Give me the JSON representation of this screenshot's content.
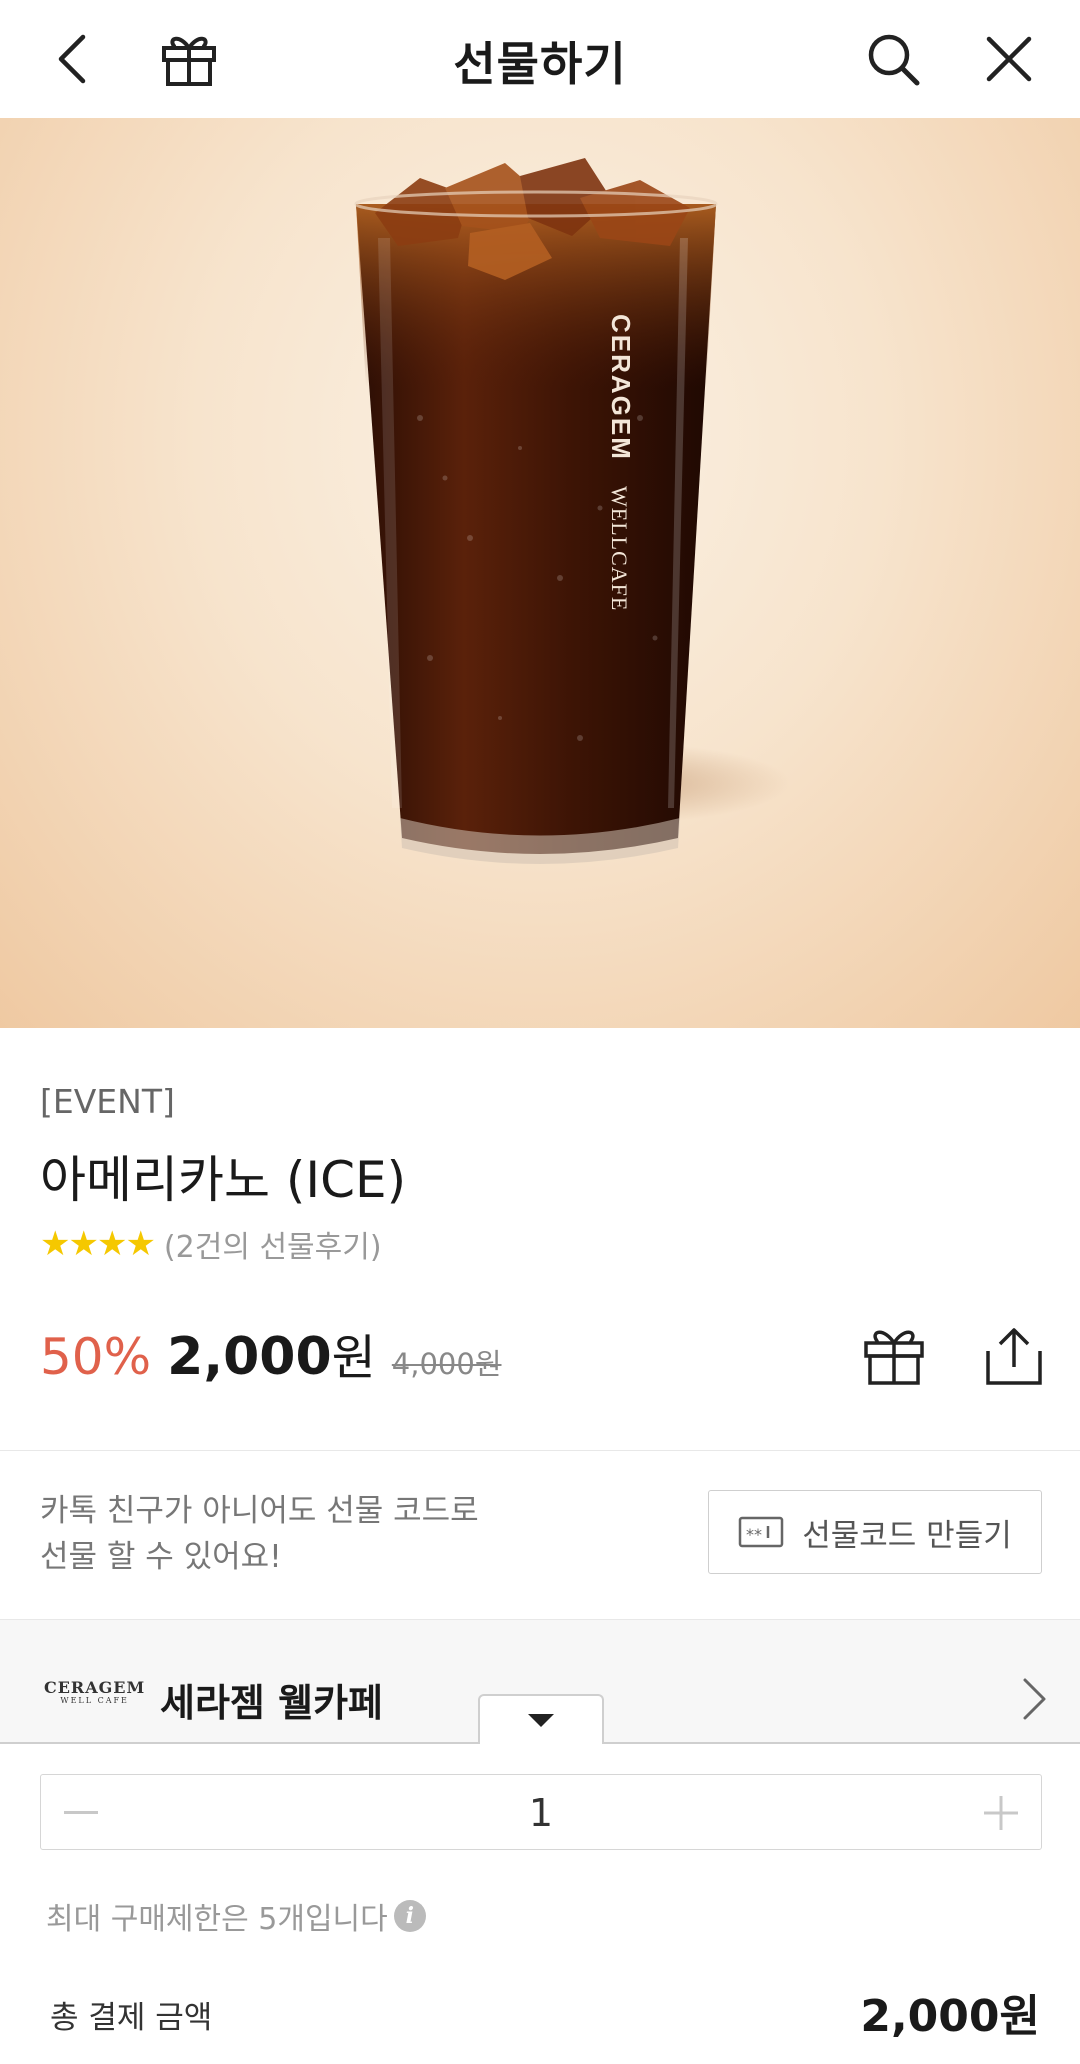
{
  "header": {
    "title": "선물하기",
    "back_icon": "chevron-left-icon",
    "gift_icon": "gift-icon",
    "search_icon": "search-icon",
    "close_icon": "close-icon"
  },
  "hero": {
    "cup_brand": "CERAGEM",
    "cup_sub": "WELLCAFE"
  },
  "product": {
    "tag": "[EVENT]",
    "name": "아메리카노 (ICE)",
    "stars": "★★★★",
    "review": "(2건의 선물후기)",
    "discount": "50%",
    "price": "2,000",
    "currency": "원",
    "original_price": "4,000원"
  },
  "gift_code": {
    "note_line1": "카톡 친구가 아니어도 선물 코드로",
    "note_line2": "선물 할 수 있어요!",
    "button_label": "선물코드 만들기"
  },
  "brand": {
    "logo": "CERAGEM",
    "logo_sub": "WELL CAFE",
    "name": "세라젬 웰카페"
  },
  "order": {
    "quantity": "1",
    "limit_text": "최대 구매제한은 5개입니다",
    "total_label": "총 결제 금액",
    "total_value": "2,000원"
  },
  "colors": {
    "discount": "#e0614b",
    "star": "#f5c800",
    "hero_bg": "#f7e4cd"
  }
}
